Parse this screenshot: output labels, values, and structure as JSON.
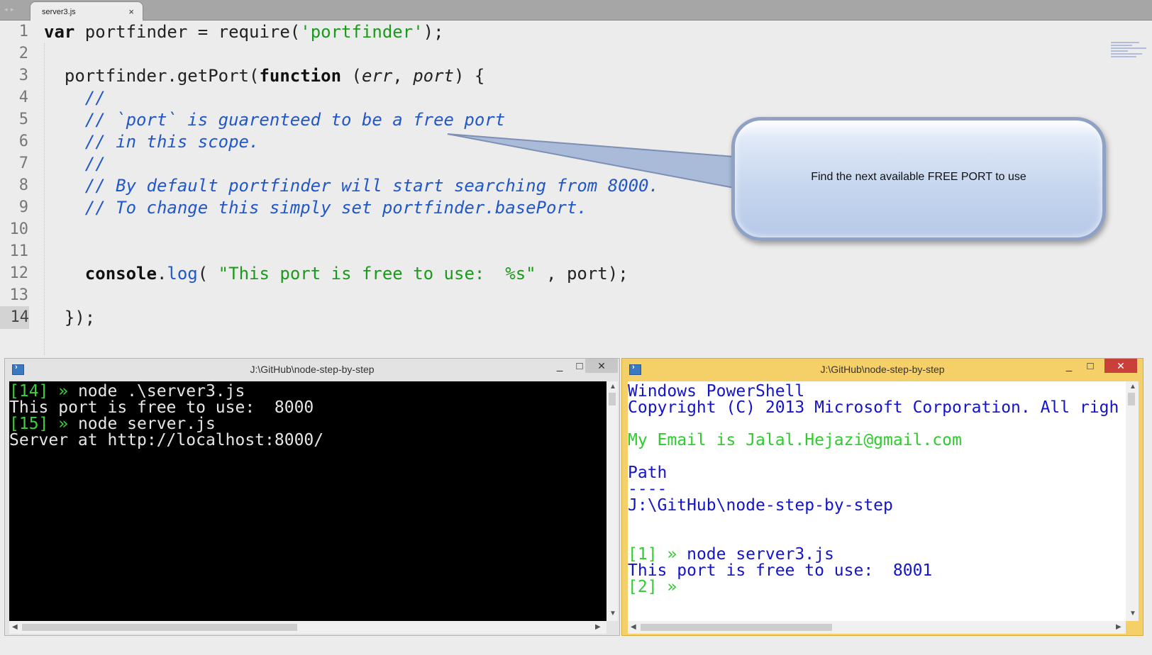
{
  "tab": {
    "filename": "server3.js",
    "close_glyph": "×"
  },
  "editor": {
    "line_numbers": [
      "1",
      "2",
      "3",
      "4",
      "5",
      "6",
      "7",
      "8",
      "9",
      "10",
      "11",
      "12",
      "13",
      "14"
    ],
    "active_line": "14",
    "l1": {
      "kw": "var",
      "a": " portfinder = require(",
      "s": "'portfinder'",
      "b": ");"
    },
    "l3": {
      "a": "  portfinder.getPort(",
      "kw": "function",
      "b": " (",
      "p1": "err",
      "c": ", ",
      "p2": "port",
      "d": ") {"
    },
    "l4": "    //",
    "l5": "    // `port` is guarenteed to be a free port",
    "l6": "    // in this scope.",
    "l7": "    //",
    "l8": "    // By default portfinder will start searching from 8000.",
    "l9": "    // To change this simply set portfinder.basePort.",
    "l12": {
      "indent": "    ",
      "kw": "console",
      "dot": ".",
      "fn": "log",
      "a": "( ",
      "s": "\"This port is free to use:  %s\"",
      "b": " , port);"
    },
    "l14": "  });"
  },
  "callout": {
    "text": "Find the next available FREE PORT to use"
  },
  "console_left": {
    "title": "J:\\GitHub\\node-step-by-step",
    "lines": [
      {
        "prompt": "[14] »",
        "text": " node .\\server3.js"
      },
      {
        "prompt": "",
        "text": "This port is free to use:  8000"
      },
      {
        "prompt": "[15] »",
        "text": " node server.js"
      },
      {
        "prompt": "",
        "text": "Server at http://localhost:8000/"
      }
    ]
  },
  "console_right": {
    "title": "J:\\GitHub\\node-step-by-step",
    "header1": "Windows PowerShell",
    "header2": "Copyright (C) 2013 Microsoft Corporation. All righ",
    "email": "My Email is Jalal.Hejazi@gmail.com",
    "path_label": "Path",
    "path_sep": "----",
    "path_value": "J:\\GitHub\\node-step-by-step",
    "p1": "[1] »",
    "cmd1": " node server3.js",
    "out1": "This port is free to use:  8001",
    "p2": "[2] »"
  },
  "window_controls": {
    "minimize": "_",
    "maximize": "□",
    "close": "✕"
  }
}
